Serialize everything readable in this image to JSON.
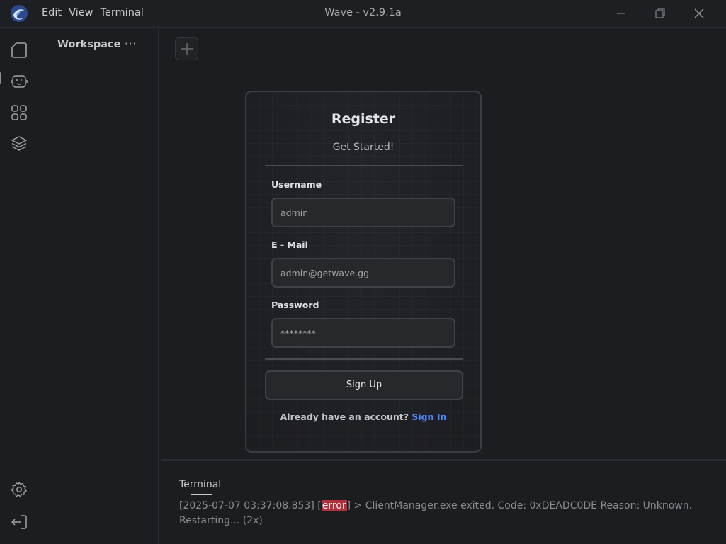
{
  "app": {
    "title": "Wave - v2.9.1a",
    "menu": [
      "Edit",
      "View",
      "Terminal"
    ]
  },
  "sidebar": {
    "top_icons": [
      "file-icon",
      "robot-icon",
      "apps-grid-icon",
      "layers-icon"
    ],
    "bottom_icons": [
      "gear-icon",
      "logout-icon"
    ],
    "active_index": 0
  },
  "workspace": {
    "title": "Workspace",
    "more": "···"
  },
  "register": {
    "title": "Register",
    "subtitle": "Get Started!",
    "username_label": "Username",
    "username_value": "admin",
    "email_label": "E - Mail",
    "email_value": "admin@getwave.gg",
    "password_label": "Password",
    "password_value": "********",
    "signup_label": "Sign Up",
    "already_text": "Already have an account?",
    "signin_link": "Sign In"
  },
  "terminal": {
    "tab_label": "Terminal",
    "log_timestamp": "[2025-07-07 03:37:08.853]",
    "log_level": "error",
    "log_message": "> ClientManager.exe exited. Code: 0xDEADC0DE Reason: Unknown. Restarting... (2x)"
  },
  "colors": {
    "background": "#1c1d21",
    "accent_link": "#4f8cff",
    "error_badge": "#b0313b"
  }
}
